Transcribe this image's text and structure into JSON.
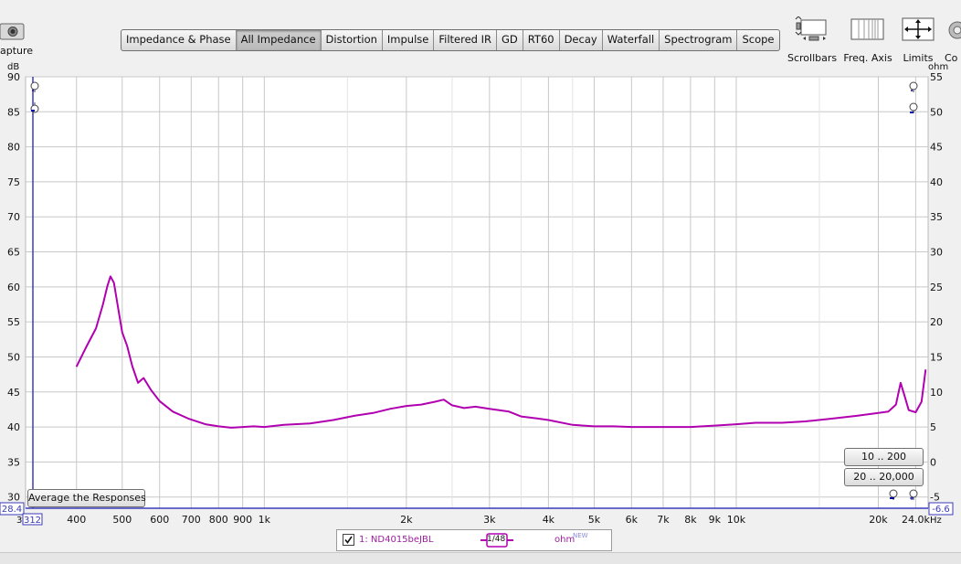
{
  "toolbar": {
    "capture_label": "apture",
    "tabs": [
      {
        "label": "Impedance & Phase"
      },
      {
        "label": "All Impedance"
      },
      {
        "label": "Distortion"
      },
      {
        "label": "Impulse"
      },
      {
        "label": "Filtered IR"
      },
      {
        "label": "GD"
      },
      {
        "label": "RT60"
      },
      {
        "label": "Decay"
      },
      {
        "label": "Waterfall"
      },
      {
        "label": "Spectrogram"
      },
      {
        "label": "Scope"
      }
    ],
    "active_tab": "All Impedance",
    "tools": [
      {
        "label": "Scrollbars",
        "icon": "scrollbars-icon"
      },
      {
        "label": "Freq. Axis",
        "icon": "freq-axis-icon"
      },
      {
        "label": "Limits",
        "icon": "limits-icon"
      },
      {
        "label": "Co",
        "icon": "controls-icon"
      }
    ]
  },
  "axes": {
    "left_unit": "dB",
    "right_unit": "ohm",
    "x_unit": "Hz",
    "left_min_value": "28.4",
    "right_min_value": "-6.6",
    "x_start_value": "312",
    "x_start_prefix": "3"
  },
  "buttons": {
    "average": "Average the Responses",
    "range_10_200": "10 .. 200",
    "range_20_20000": "20 .. 20,000"
  },
  "legend": {
    "checked": true,
    "name": "1: ND4015beJBL",
    "smoothing": "1/48",
    "unit": "ohm",
    "badge": "NEW"
  },
  "colors": {
    "trace": "#b000b0",
    "grid": "#c8c8c8",
    "axis_box": "#3b3bb8"
  },
  "chart_data": {
    "type": "line",
    "x_scale": "log",
    "xlim": [
      312,
      25500
    ],
    "ylim_left": [
      28.4,
      90
    ],
    "ylim_right": [
      -6.6,
      55
    ],
    "left_ticks": [
      30,
      35,
      40,
      45,
      50,
      55,
      60,
      65,
      70,
      75,
      80,
      85,
      90
    ],
    "right_ticks": [
      -5,
      0,
      5,
      10,
      15,
      20,
      25,
      30,
      35,
      40,
      45,
      50,
      55
    ],
    "x_ticks": [
      {
        "v": 400,
        "label": "400"
      },
      {
        "v": 500,
        "label": "500"
      },
      {
        "v": 600,
        "label": "600"
      },
      {
        "v": 700,
        "label": "700"
      },
      {
        "v": 800,
        "label": "800"
      },
      {
        "v": 900,
        "label": "900"
      },
      {
        "v": 1000,
        "label": "1k"
      },
      {
        "v": 2000,
        "label": "2k"
      },
      {
        "v": 3000,
        "label": "3k"
      },
      {
        "v": 4000,
        "label": "4k"
      },
      {
        "v": 5000,
        "label": "5k"
      },
      {
        "v": 6000,
        "label": "6k"
      },
      {
        "v": 7000,
        "label": "7k"
      },
      {
        "v": 8000,
        "label": "8k"
      },
      {
        "v": 9000,
        "label": "9k"
      },
      {
        "v": 10000,
        "label": "10k"
      },
      {
        "v": 20000,
        "label": "20k"
      },
      {
        "v": 24000,
        "label": "24.0k"
      }
    ],
    "x_minor": [
      1500,
      2500,
      3500,
      4500,
      15000
    ],
    "series": [
      {
        "axis": "right",
        "color": "#b000b0",
        "points": [
          [
            400,
            13.6
          ],
          [
            420,
            16.5
          ],
          [
            440,
            19.1
          ],
          [
            455,
            22.5
          ],
          [
            465,
            25.1
          ],
          [
            472,
            26.5
          ],
          [
            480,
            25.6
          ],
          [
            490,
            22.0
          ],
          [
            500,
            18.5
          ],
          [
            512,
            16.6
          ],
          [
            525,
            13.7
          ],
          [
            540,
            11.3
          ],
          [
            555,
            12.0
          ],
          [
            575,
            10.3
          ],
          [
            600,
            8.7
          ],
          [
            640,
            7.2
          ],
          [
            690,
            6.2
          ],
          [
            750,
            5.4
          ],
          [
            800,
            5.1
          ],
          [
            850,
            4.9
          ],
          [
            900,
            5.0
          ],
          [
            950,
            5.1
          ],
          [
            1000,
            5.0
          ],
          [
            1100,
            5.3
          ],
          [
            1250,
            5.5
          ],
          [
            1400,
            6.0
          ],
          [
            1550,
            6.6
          ],
          [
            1700,
            7.0
          ],
          [
            1850,
            7.6
          ],
          [
            2000,
            8.0
          ],
          [
            2150,
            8.2
          ],
          [
            2300,
            8.6
          ],
          [
            2400,
            8.9
          ],
          [
            2500,
            8.1
          ],
          [
            2650,
            7.7
          ],
          [
            2800,
            7.9
          ],
          [
            3000,
            7.6
          ],
          [
            3300,
            7.2
          ],
          [
            3500,
            6.5
          ],
          [
            3800,
            6.2
          ],
          [
            4000,
            6.0
          ],
          [
            4500,
            5.3
          ],
          [
            5000,
            5.1
          ],
          [
            5500,
            5.1
          ],
          [
            6000,
            5.0
          ],
          [
            7000,
            5.0
          ],
          [
            8000,
            5.0
          ],
          [
            9000,
            5.2
          ],
          [
            10000,
            5.4
          ],
          [
            11000,
            5.6
          ],
          [
            12500,
            5.6
          ],
          [
            14000,
            5.8
          ],
          [
            16000,
            6.2
          ],
          [
            18000,
            6.6
          ],
          [
            20000,
            7.0
          ],
          [
            21000,
            7.2
          ],
          [
            21800,
            8.2
          ],
          [
            22300,
            11.3
          ],
          [
            22700,
            9.6
          ],
          [
            23200,
            7.4
          ],
          [
            24000,
            7.1
          ],
          [
            24700,
            8.6
          ],
          [
            25200,
            13.2
          ]
        ]
      }
    ]
  }
}
